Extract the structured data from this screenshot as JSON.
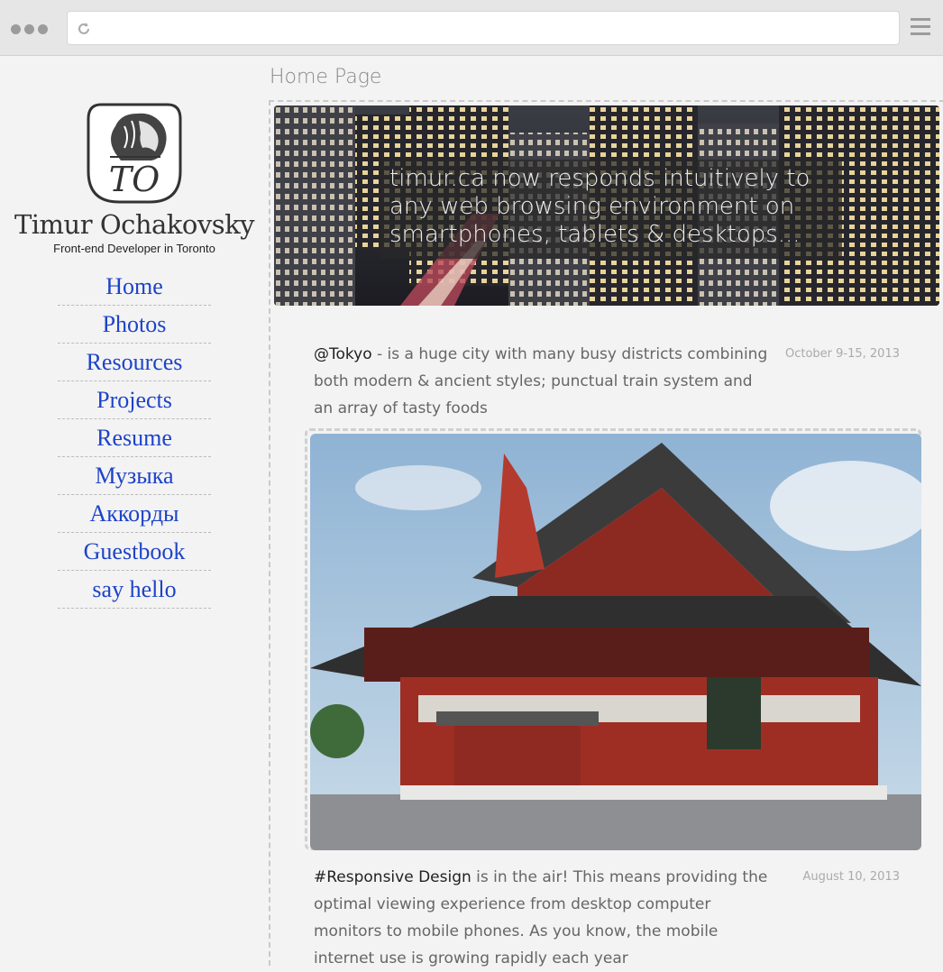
{
  "browser": {
    "icons": {
      "reload": "reload-icon",
      "menu": "hamburger-menu-icon",
      "dots": "window-dots-icon"
    }
  },
  "sidebar": {
    "logo_text": "TO",
    "name": "Timur Ochakovsky",
    "tagline": "Front-end Developer in Toronto",
    "nav": [
      {
        "label": "Home"
      },
      {
        "label": "Photos"
      },
      {
        "label": "Resources"
      },
      {
        "label": "Projects"
      },
      {
        "label": "Resume"
      },
      {
        "label": "Музыка"
      },
      {
        "label": "Аккорды"
      },
      {
        "label": "Guestbook"
      },
      {
        "label": "say hello"
      }
    ]
  },
  "main": {
    "page_title": "Home Page",
    "banner": {
      "caption": "timur.ca now responds intuitively to any web browsing environment on smartphones, tablets & desktops..."
    },
    "posts": [
      {
        "tag": "@Tokyo",
        "text": " - is a huge city with many busy districts combining both modern & ancient styles; punctual train system and an array of tasty foods",
        "date": "October 9-15, 2013"
      },
      {
        "tag": "#Responsive Design",
        "text": " is in the air! This means providing the optimal viewing experience from desktop computer monitors to mobile phones. As you know, the mobile internet use is growing rapidly each year",
        "date": "August 10, 2013"
      }
    ]
  },
  "colors": {
    "nav_link": "#1d43c9",
    "background": "#f3f3f3"
  }
}
